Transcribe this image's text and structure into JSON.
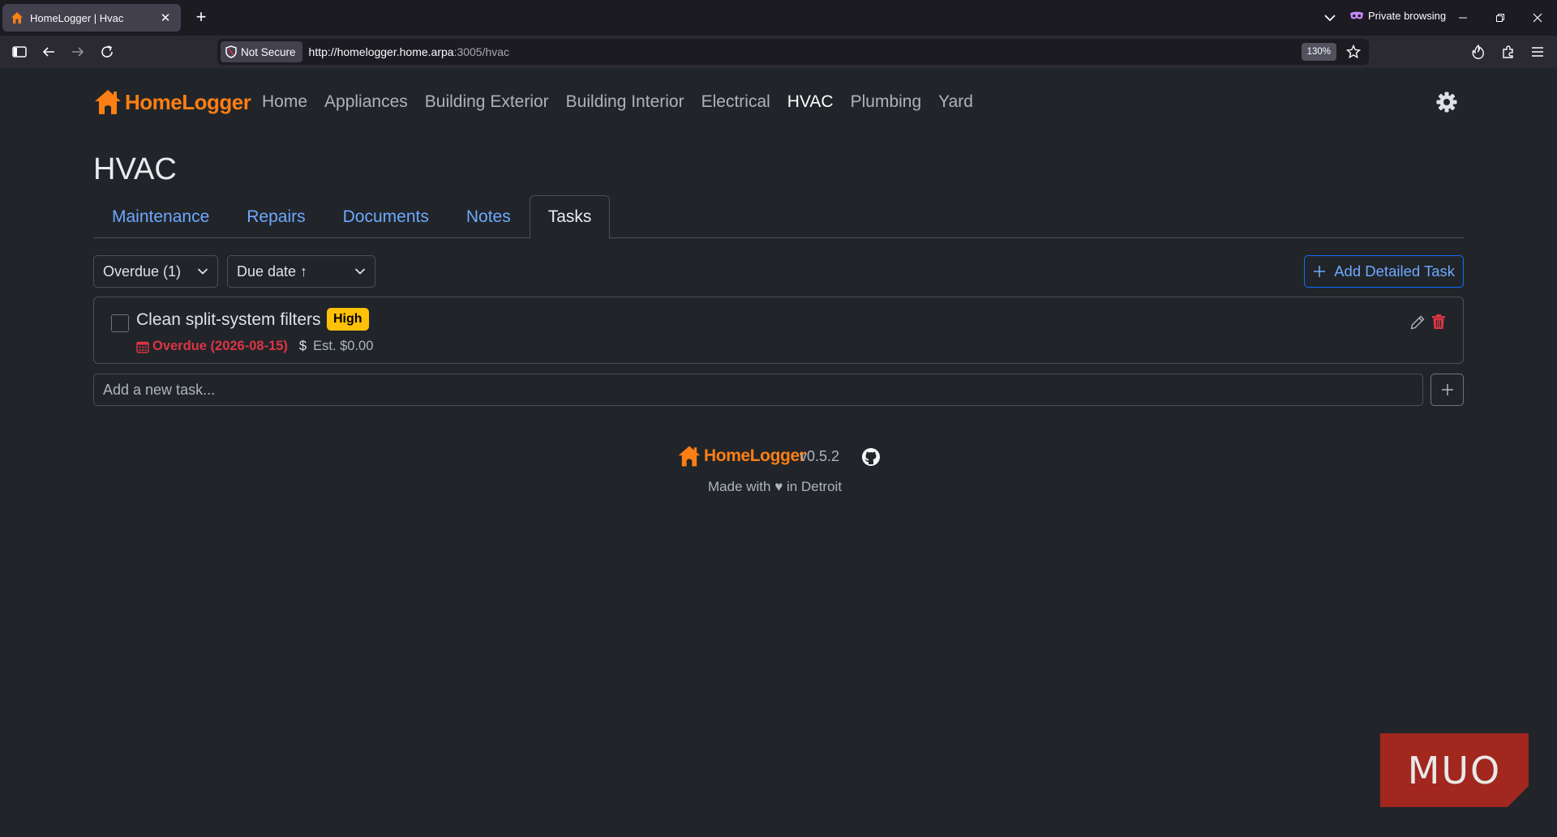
{
  "browser": {
    "tab_title": "HomeLogger | Hvac",
    "private_label": "Private browsing",
    "security_label": "Not Secure",
    "url_host": "http://homelogger.home.arpa",
    "url_path": ":3005/hvac",
    "zoom": "130%"
  },
  "app": {
    "logo_text": "HomeLogger",
    "nav": [
      "Home",
      "Appliances",
      "Building Exterior",
      "Building Interior",
      "Electrical",
      "HVAC",
      "Plumbing",
      "Yard"
    ],
    "active_nav": "HVAC",
    "page_title": "HVAC",
    "tabs": [
      "Maintenance",
      "Repairs",
      "Documents",
      "Notes",
      "Tasks"
    ],
    "active_tab": "Tasks",
    "filter_select": "Overdue (1)",
    "sort_select": "Due date ↑",
    "add_detailed_label": "Add Detailed Task",
    "task": {
      "title": "Clean split-system filters",
      "priority": "High",
      "due_text": "Overdue (2026-08-15)",
      "dollar": "$",
      "est_text": "Est. $0.00"
    },
    "new_task_placeholder": "Add a new task...",
    "footer": {
      "logo_text": "HomeLogger",
      "version": "v0.5.2",
      "made_with": "Made with ♥ in Detroit"
    }
  },
  "watermark": "MUO",
  "colors": {
    "accent_orange": "#fd7e14",
    "link_blue": "#6ea8fe",
    "danger": "#dc3545",
    "warning": "#ffc107",
    "background": "#212529"
  }
}
